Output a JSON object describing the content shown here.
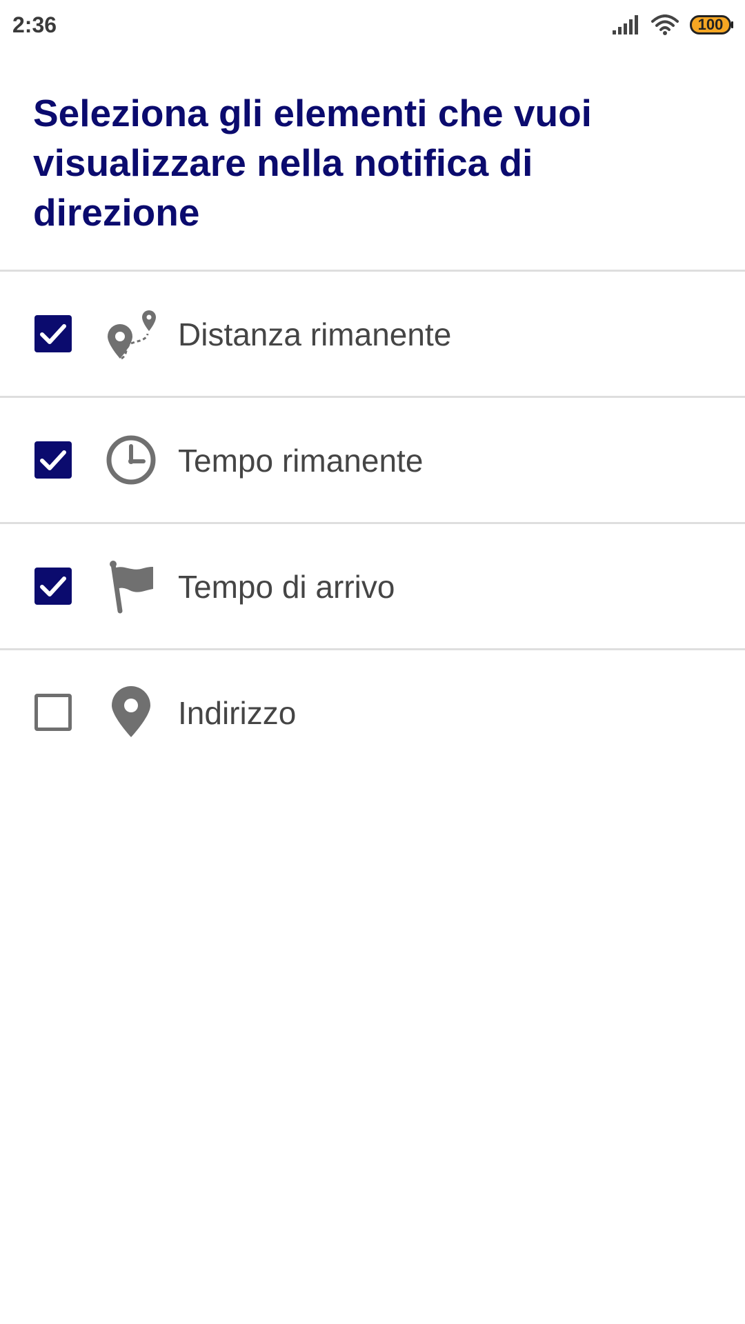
{
  "status_bar": {
    "time": "2:36",
    "battery": "100",
    "icons": [
      "signal-icon",
      "wifi-icon",
      "battery-icon"
    ],
    "battery_color": "#f5a623"
  },
  "title": "Seleziona gli elementi che vuoi visualizzare nella notifica di direzione",
  "colors": {
    "accent": "#0b0b6e",
    "icon": "#707070",
    "text": "#454545",
    "divider": "#dedede"
  },
  "options": [
    {
      "label": "Distanza rimanente",
      "icon": "route-icon",
      "checked": true
    },
    {
      "label": "Tempo rimanente",
      "icon": "clock-icon",
      "checked": true
    },
    {
      "label": "Tempo di arrivo",
      "icon": "flag-icon",
      "checked": true
    },
    {
      "label": "Indirizzo",
      "icon": "location-pin-icon",
      "checked": false
    }
  ]
}
